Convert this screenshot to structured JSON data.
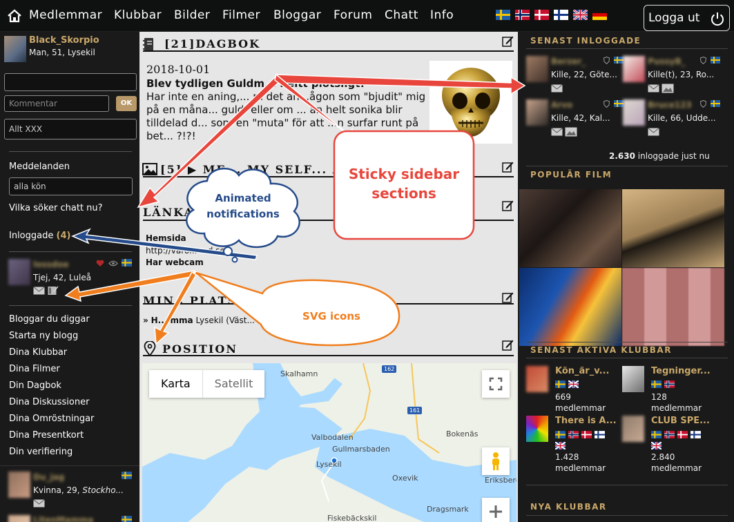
{
  "nav": {
    "items": [
      "Medlemmar",
      "Klubbar",
      "Bilder",
      "Filmer",
      "Bloggar",
      "Forum",
      "Chatt",
      "Info"
    ],
    "logout": "Logga ut"
  },
  "left": {
    "me_name": "Black_Skorpio",
    "me_info": "Man, 51, Lysekil",
    "comment_placeholder": "Kommentar",
    "ok_label": "OK",
    "filter_value": "Allt XXX",
    "messages_label": "Meddelanden",
    "gender_value": "alla kön",
    "who_seeks": "Vilka söker chatt nu?",
    "logged_in_label": "Inloggade",
    "logged_in_count": "(4)",
    "user1_info": "Tjej, 42, Luleå",
    "menu": [
      "Bloggar du diggar",
      "Starta ny blogg",
      "Dina Klubbar",
      "Dina Filmer",
      "Din Dagbok",
      "Dina Diskussioner",
      "Dina Omröstningar",
      "Dina Presentkort",
      "Din verifiering"
    ],
    "user2_info_plain": "Kvinna, 29,",
    "user2_info_italic": "Stockho..."
  },
  "main": {
    "diary_title": "[21]DAGBOK",
    "post_date": "2018-10-01",
    "post_heading": "Blev tydligen Guldm... heltt plotsligt!",
    "post_body": "Har inte en aning,... m det an...ågon som \"bjudit\" mig på en måna... guld: eller om ... an helt sonika blir tilldelad d... som en \"muta\" för att ...n surfar runt på bet... ?!?!",
    "media_title": "[5] ▶ ME,...MY SELF... AN...",
    "links_title": "LÄNKA...",
    "homepage_label": "Hemsida",
    "homepage_value": "http://varo... ...d.se *",
    "webcam_label": "Har webcam",
    "places_title": "MINA PLATS...",
    "place_prefix": "»",
    "place_bold": "H... mma",
    "place_rest": "Lysekil (Väst...",
    "position_title": "POSITION",
    "map_tab_map": "Karta",
    "map_tab_sat": "Satellit",
    "map_places": [
      "Skalhamn",
      "Valbodalen",
      "Gullmarsbaden",
      "Lysekil",
      "Bokenäs",
      "Oxevik",
      "Eriksberg",
      "Dragsmark",
      "Fiskebäckskil"
    ],
    "road_signs": [
      "162",
      "161"
    ]
  },
  "right": {
    "recent_title": "SENAST INLOGGADE",
    "recent_users": [
      {
        "info": "Kille, 22, Göte..."
      },
      {
        "info": "Kille(t), 23, Ro..."
      },
      {
        "info": "Kille, 42, Kal..."
      },
      {
        "info": "Kille, 66, Udde..."
      }
    ],
    "online_count": "2.630",
    "online_text": "inloggade just nu",
    "film_title": "POPULÄR FILM",
    "clubs_title": "SENAST AKTIVA KLUBBAR",
    "clubs": [
      {
        "name": "Kön_är_v...",
        "members": "669",
        "unit": "medlemmar"
      },
      {
        "name": "Tegninger...",
        "members": "128",
        "unit": "medlemmar"
      },
      {
        "name": "There is A...",
        "members": "1.428",
        "unit": "medlemmar"
      },
      {
        "name": "CLUB SPE...",
        "members": "2.840",
        "unit": "medlemmar"
      }
    ],
    "new_clubs_title": "NYA KLUBBAR"
  },
  "annotations": {
    "sticky_line1": "Sticky sidebar",
    "sticky_line2": "sections",
    "animated_line1": "Animated",
    "animated_line2": "notifications",
    "svg": "SVG icons"
  },
  "colors": {
    "accent_gold": "#c9a86a",
    "sidebar_bg": "#1a1a1a",
    "content_bg": "#e6e6e6",
    "arrow_red": "#e8463c",
    "arrow_blue": "#254b8a",
    "arrow_orange": "#f07e1e"
  },
  "icons": [
    "home-icon",
    "power-icon",
    "heart-icon",
    "eye-icon",
    "shield-icon",
    "mail-icon",
    "book-icon",
    "edit-icon",
    "photo-icon",
    "play-icon",
    "pin-icon",
    "fullscreen-icon",
    "pegman-icon",
    "zoom-in-icon"
  ]
}
